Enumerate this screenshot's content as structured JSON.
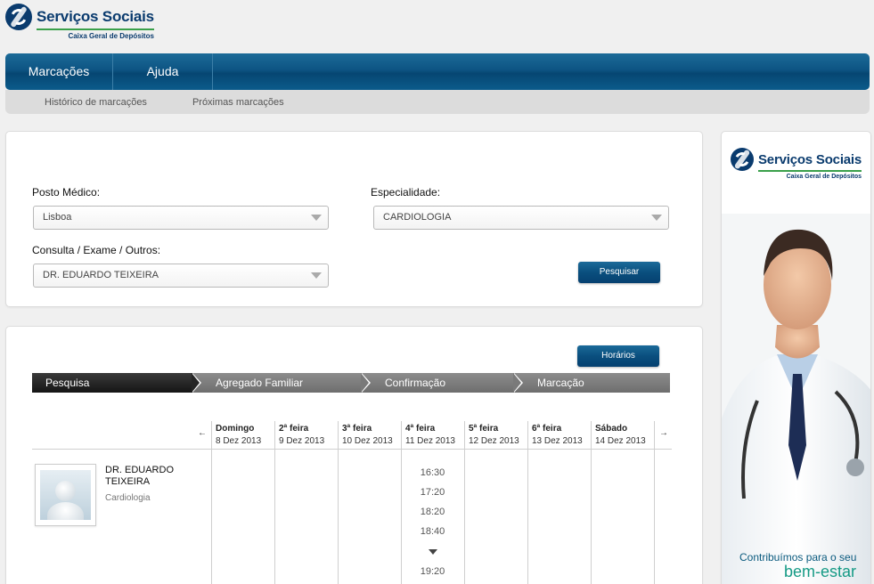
{
  "brand": {
    "title": "Serviços Sociais",
    "subtitle": "Caixa Geral de Depósitos"
  },
  "nav": {
    "items": [
      "Marcações",
      "Ajuda"
    ],
    "sub_items": [
      "Histórico de marcações",
      "Próximas marcações"
    ]
  },
  "search": {
    "posto_label": "Posto Médico:",
    "posto_value": "Lisboa",
    "especialidade_label": "Especialidade:",
    "especialidade_value": "CARDIOLOGIA",
    "consulta_label": "Consulta / Exame / Outros:",
    "consulta_value": "DR. EDUARDO TEIXEIRA",
    "search_button": "Pesquisar"
  },
  "results": {
    "horarios_button": "Horários",
    "steps": [
      "Pesquisa",
      "Agregado Familiar",
      "Confirmação",
      "Marcação"
    ],
    "prev_arrow": "←",
    "next_arrow": "→",
    "days": [
      {
        "name": "Domingo",
        "date": "8 Dez 2013"
      },
      {
        "name": "2ª feira",
        "date": "9 Dez 2013"
      },
      {
        "name": "3ª feira",
        "date": "10 Dez 2013"
      },
      {
        "name": "4ª feira",
        "date": "11 Dez 2013"
      },
      {
        "name": "5ª feira",
        "date": "12 Dez 2013"
      },
      {
        "name": "6ª feira",
        "date": "13 Dez 2013"
      },
      {
        "name": "Sábado",
        "date": "14 Dez 2013"
      }
    ],
    "doctor": {
      "name": "DR. EDUARDO TEIXEIRA",
      "specialty": "Cardiologia"
    },
    "slots_wednesday": [
      "16:30",
      "17:20",
      "18:20",
      "18:40",
      "19:20"
    ]
  },
  "ad": {
    "slogan_line1": "Contribuímos para o seu",
    "slogan_line2": "bem-estar"
  },
  "colors": {
    "primary_blue": "#0a4f7e",
    "brand_green": "#3aa04a",
    "background": "#f0f0f0"
  }
}
